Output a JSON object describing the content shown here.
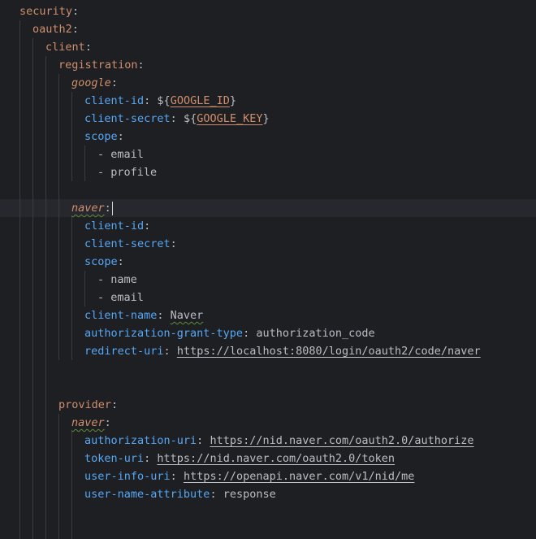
{
  "yaml": {
    "security": "security",
    "oauth2": "oauth2",
    "client": "client",
    "registration": "registration",
    "google": {
      "key": "google",
      "client_id_key": "client-id",
      "client_id_prefix": "${",
      "client_id_var": "GOOGLE_ID",
      "client_id_suffix": "}",
      "client_secret_key": "client-secret",
      "client_secret_prefix": "${",
      "client_secret_var": "GOOGLE_KEY",
      "client_secret_suffix": "}",
      "scope_key": "scope",
      "scope_items": [
        "email",
        "profile"
      ]
    },
    "naver": {
      "key": "naver",
      "client_id_key": "client-id",
      "client_secret_key": "client-secret",
      "scope_key": "scope",
      "scope_items": [
        "name",
        "email"
      ],
      "client_name_key": "client-name",
      "client_name_value": "Naver",
      "grant_type_key": "authorization-grant-type",
      "grant_type_value": "authorization_code",
      "redirect_uri_key": "redirect-uri",
      "redirect_uri_value": "https://localhost:8080/login/oauth2/code/naver"
    },
    "provider": {
      "key": "provider",
      "naver_key": "naver",
      "authorization_uri_key": "authorization-uri",
      "authorization_uri_value": "https://nid.naver.com/oauth2.0/authorize",
      "token_uri_key": "token-uri",
      "token_uri_value": "https://nid.naver.com/oauth2.0/token",
      "user_info_uri_key": "user-info-uri",
      "user_info_uri_value": "https://openapi.naver.com/v1/nid/me",
      "user_name_attribute_key": "user-name-attribute",
      "user_name_attribute_value": "response"
    }
  },
  "colors": {
    "background": "#1e1f22",
    "key_orange": "#cf8e6d",
    "key_blue": "#56a8f5",
    "text": "#bcbec4",
    "guide": "#393b40",
    "caret_line": "#26282e"
  }
}
